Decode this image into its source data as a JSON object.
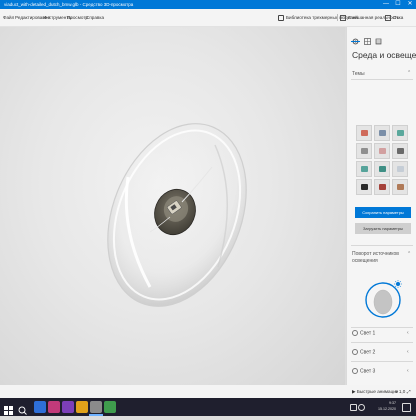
{
  "window": {
    "title": "viaduct_with-detailed_dutch_bmw.glb - Средство 3D-просмотра",
    "minimize": "—",
    "maximize": "☐",
    "close": "✕"
  },
  "menu": {
    "items": [
      "Файл",
      "Редактирование",
      "Инструменты",
      "Просмотр",
      "Справка"
    ],
    "library_label": "Библиотека трехмерных моделей",
    "mixed_reality_label": "Смешанная реальность",
    "other_label": "Отка"
  },
  "panel": {
    "title": "Среда и освещение",
    "themes_label": "Темы",
    "apply_button": "Сохранить параметры",
    "reset_button": "Загрузить параметры",
    "rotate_label_line1": "Поворот источников",
    "rotate_label_line2": "освещения",
    "lights": [
      "Свет 1",
      "Свет 2",
      "Свет 3"
    ]
  },
  "themes": {
    "colors": [
      "#cf6a5a",
      "#7b8fa8",
      "#5aa89c",
      "#8f8f8f",
      "#d2a0a0",
      "#6a6a6a",
      "#56a39a",
      "#3f8f85",
      "#c5cdd6",
      "#2a2a2a",
      "#a5413a",
      "#b07a58"
    ]
  },
  "status": {
    "grid_label": "Быстрые анимации",
    "zoom": "1,0"
  },
  "taskbar": {
    "time": "9:37",
    "date": "15.12.2020"
  },
  "colors": {
    "accent": "#0078d7"
  }
}
